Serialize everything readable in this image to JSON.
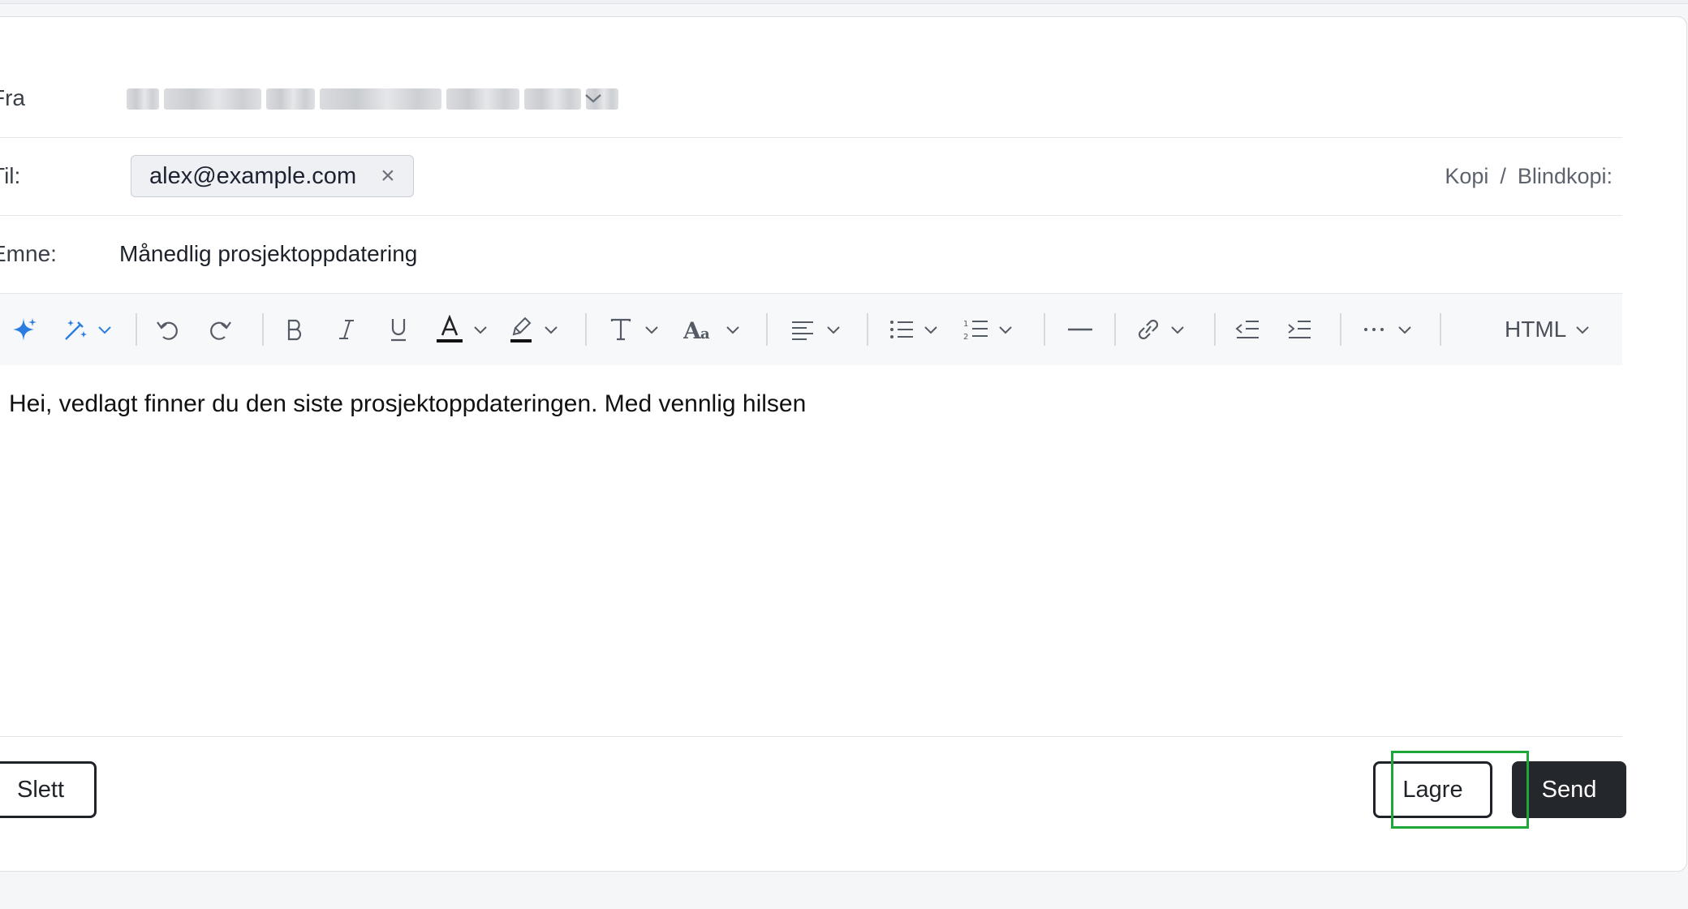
{
  "compose": {
    "from": {
      "label": "Fra"
    },
    "to": {
      "label": "Til:",
      "recipient": "alex@example.com",
      "cc_label": "Kopi",
      "separator": "/",
      "bcc_label": "Blindkopi:"
    },
    "subject": {
      "label": "Emne:",
      "value": "Månedlig prosjektoppdatering"
    },
    "toolbar": {
      "icons": [
        "ai-sparkle-icon",
        "magic-wand-icon",
        "undo-icon",
        "redo-icon",
        "bold-icon",
        "italic-icon",
        "underline-icon",
        "font-color-icon",
        "highlight-icon",
        "text-style-icon",
        "font-size-icon",
        "align-icon",
        "bullet-list-icon",
        "numbered-list-icon",
        "horizontal-rule-icon",
        "link-icon",
        "outdent-icon",
        "indent-icon",
        "more-icon"
      ],
      "mode_label": "HTML"
    },
    "body_text": "Hei, vedlagt finner du den siste prosjektoppdateringen. Med vennlig hilsen",
    "buttons": {
      "delete": "Slett",
      "save": "Lagre",
      "send": "Send"
    }
  },
  "colors": {
    "accent": "#2a7de1",
    "primary_button": "#24272c",
    "highlight_frame": "#1fa83a",
    "chip_bg": "#eef0f3"
  }
}
